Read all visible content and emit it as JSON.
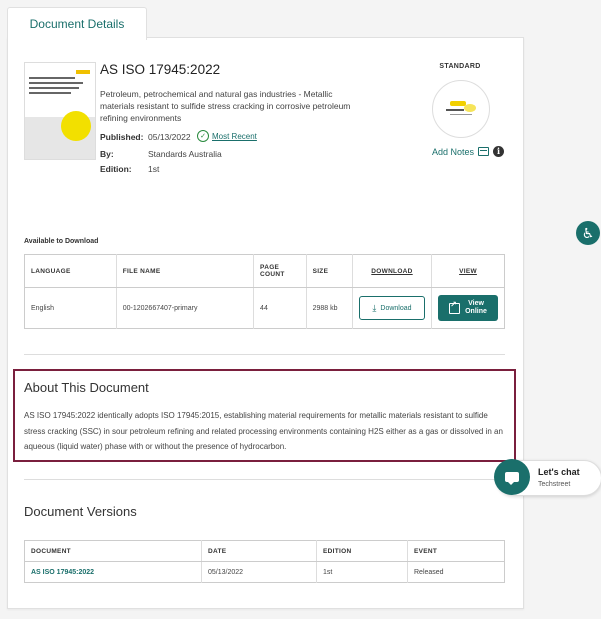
{
  "tab": {
    "label": "Document Details"
  },
  "document": {
    "title": "AS ISO 17945:2022",
    "description": "Petroleum, petrochemical and natural gas industries - Metallic materials resistant to sulfide stress cracking in corrosive petroleum refining environments",
    "published_label": "Published:",
    "published_value": "05/13/2022",
    "most_recent": "Most Recent",
    "by_label": "By:",
    "by_value": "Standards Australia",
    "edition_label": "Edition:",
    "edition_value": "1st"
  },
  "standard": {
    "label": "STANDARD",
    "add_notes": "Add Notes"
  },
  "download": {
    "section_label": "Available to Download",
    "headers": {
      "language": "LANGUAGE",
      "file_name": "FILE NAME",
      "page_count": "PAGE COUNT",
      "size": "SIZE",
      "download": "DOWNLOAD",
      "view": "VIEW"
    },
    "row": {
      "language": "English",
      "file_name": "00-1202667407-primary",
      "page_count": "44",
      "size": "2988 kb"
    },
    "download_button": "Download",
    "view_button_line1": "View",
    "view_button_line2": "Online"
  },
  "about": {
    "title": "About This Document",
    "text": "AS ISO 17945:2022 identically adopts ISO 17945:2015, establishing material requirements for metallic materials resistant to sulfide stress cracking (SSC) in sour petroleum refining and related processing environments containing H2S either as a gas or dissolved in an aqueous (liquid water) phase with or without the presence of hydrocarbon."
  },
  "versions": {
    "title": "Document Versions",
    "headers": {
      "document": "DOCUMENT",
      "date": "DATE",
      "edition": "EDITION",
      "event": "EVENT"
    },
    "rows": [
      {
        "document": "AS ISO 17945:2022",
        "date": "05/13/2022",
        "edition": "1st",
        "event": "Released"
      }
    ]
  },
  "chat": {
    "title": "Let's chat",
    "subtitle": "Techstreet"
  },
  "colors": {
    "accent": "#1a6f6b",
    "highlight_border": "#7a1f3d"
  },
  "icons": {
    "accessibility": "accessibility-icon",
    "chat": "chat-icon"
  }
}
